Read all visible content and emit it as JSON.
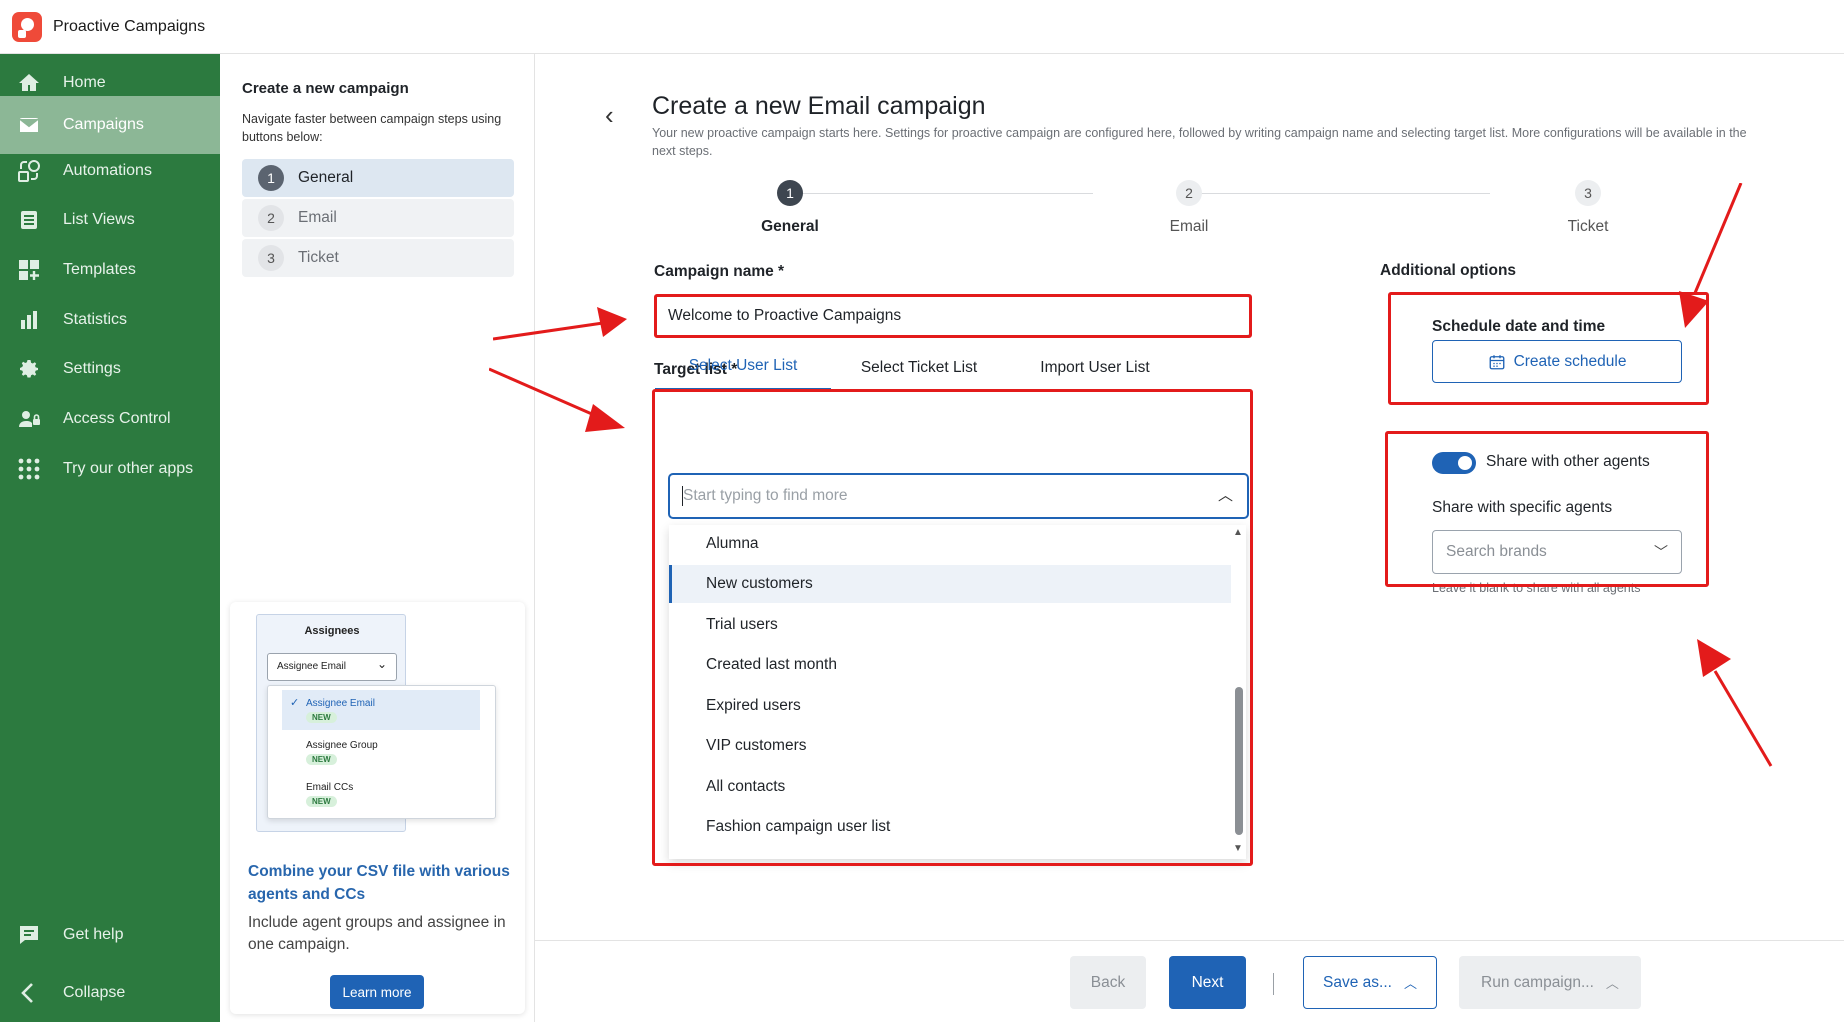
{
  "app": {
    "title": "Proactive Campaigns"
  },
  "sidebar": {
    "items": [
      {
        "label": "Home",
        "icon": "home-icon"
      },
      {
        "label": "Campaigns",
        "icon": "mail-icon",
        "active": true
      },
      {
        "label": "Automations",
        "icon": "automation-icon"
      },
      {
        "label": "List Views",
        "icon": "list-icon"
      },
      {
        "label": "Templates",
        "icon": "templates-icon"
      },
      {
        "label": "Statistics",
        "icon": "chart-icon"
      },
      {
        "label": "Settings",
        "icon": "gear-icon"
      },
      {
        "label": "Access Control",
        "icon": "user-lock-icon"
      },
      {
        "label": "Try our other apps",
        "icon": "grid-dots-icon"
      }
    ],
    "bottom": [
      {
        "label": "Get help",
        "icon": "chat-icon"
      },
      {
        "label": "Collapse",
        "icon": "chevron-left-icon"
      }
    ]
  },
  "steps_panel": {
    "title": "Create a new campaign",
    "description": "Navigate faster between campaign steps using buttons below:",
    "steps": [
      {
        "num": "1",
        "label": "General",
        "active": true
      },
      {
        "num": "2",
        "label": "Email"
      },
      {
        "num": "3",
        "label": "Ticket"
      }
    ],
    "promo": {
      "image": {
        "heading": "Assignees",
        "select_value": "Assignee Email",
        "options": [
          "Assignee Email",
          "Assignee Group",
          "Email CCs"
        ],
        "badge": "NEW"
      },
      "heading": "Combine your CSV file with various agents and CCs",
      "body": "Include agent groups and assignee in one campaign.",
      "button": "Learn more"
    }
  },
  "main": {
    "title": "Create a new Email campaign",
    "subtitle": "Your new proactive campaign starts here. Settings for proactive campaign are configured here, followed by writing campaign name and selecting target list. More configurations will be available in the next steps.",
    "stepper": [
      {
        "num": "1",
        "label": "General",
        "active": true
      },
      {
        "num": "2",
        "label": "Email"
      },
      {
        "num": "3",
        "label": "Ticket"
      }
    ],
    "campaign_name": {
      "label": "Campaign name *",
      "value": "Welcome to Proactive Campaigns"
    },
    "target_list": {
      "label": "Target list *",
      "tabs": [
        "Select User List",
        "Select Ticket List",
        "Import User List"
      ],
      "active_tab": 0,
      "search_placeholder": "Start typing to find more",
      "options": [
        "Alumna",
        "New customers",
        "Trial users",
        "Created last month",
        "Expired users",
        "VIP customers",
        "All contacts",
        "Fashion campaign user list"
      ],
      "selected_option": "New customers"
    },
    "additional": {
      "title": "Additional options",
      "schedule_label": "Schedule date and time",
      "schedule_button": "Create schedule",
      "share_toggle_label": "Share with other agents",
      "share_toggle_on": true,
      "specific_label": "Share with specific agents",
      "brands_placeholder": "Search brands",
      "help_text": "Leave it blank to share with all agents"
    },
    "footer": {
      "back": "Back",
      "next": "Next",
      "save": "Save as...",
      "run": "Run campaign..."
    }
  },
  "colors": {
    "sidebar": "#2c7a3f",
    "accent": "#1f63b5",
    "annotation_red": "#e31b1b",
    "logo": "#ef4a39"
  }
}
